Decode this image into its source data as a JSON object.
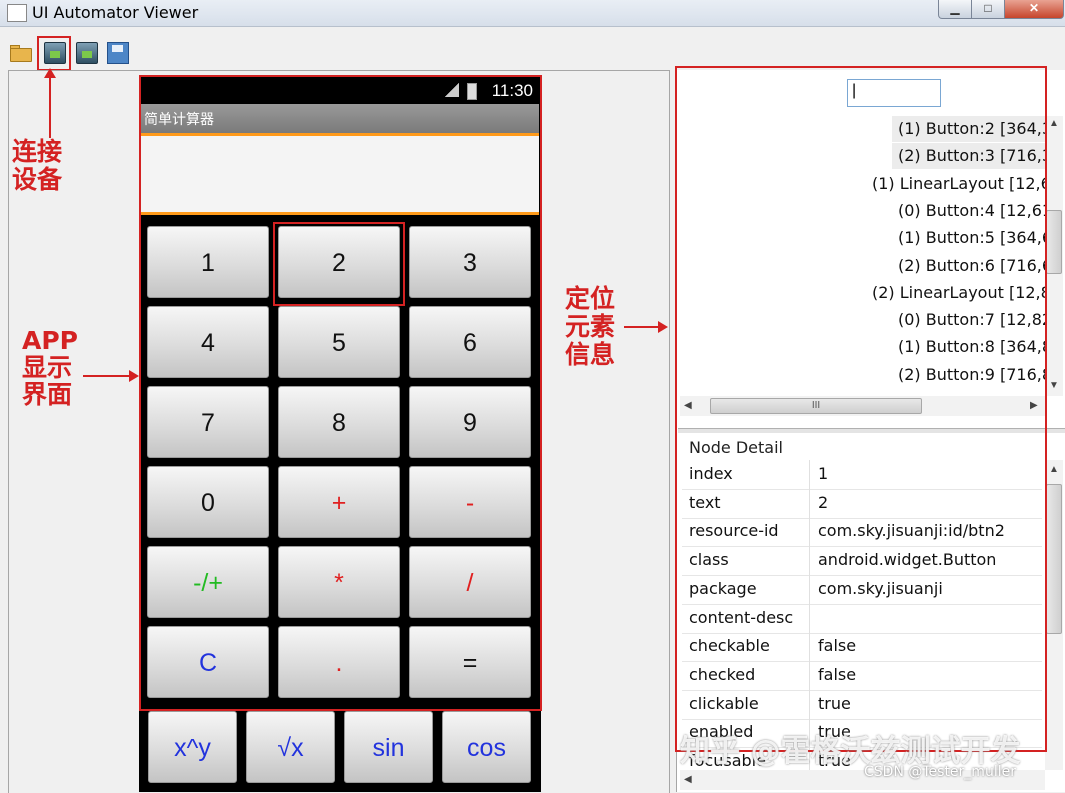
{
  "window": {
    "title": "UI Automator Viewer",
    "minimize_label": "▁",
    "maximize_label": "□",
    "close_label": "✕"
  },
  "toolbar": {
    "icons": [
      "open-folder-icon",
      "device-screenshot-icon",
      "device-screenshot-compressed-icon",
      "save-icon"
    ]
  },
  "device": {
    "time": "11:30",
    "app_title": "简单计算器",
    "buttons": [
      {
        "label": "1",
        "color": "#111111"
      },
      {
        "label": "2",
        "color": "#111111"
      },
      {
        "label": "3",
        "color": "#111111"
      },
      {
        "label": "4",
        "color": "#111111"
      },
      {
        "label": "5",
        "color": "#111111"
      },
      {
        "label": "6",
        "color": "#111111"
      },
      {
        "label": "7",
        "color": "#111111"
      },
      {
        "label": "8",
        "color": "#111111"
      },
      {
        "label": "9",
        "color": "#111111"
      },
      {
        "label": "0",
        "color": "#111111"
      },
      {
        "label": "+",
        "color": "#e02020"
      },
      {
        "label": "-",
        "color": "#e02020"
      },
      {
        "label": "-/+",
        "color": "#22bb22"
      },
      {
        "label": "*",
        "color": "#e02020"
      },
      {
        "label": "/",
        "color": "#e02020"
      },
      {
        "label": "C",
        "color": "#2233dd"
      },
      {
        "label": ".",
        "color": "#e02020"
      },
      {
        "label": "=",
        "color": "#111111"
      }
    ],
    "function_buttons": [
      "x^y",
      "√x",
      "sin",
      "cos"
    ]
  },
  "annotations": {
    "connect_device": "连接设备",
    "app_display": "APP显示界面",
    "locate_element": "定位元素信息"
  },
  "tree": {
    "rows": [
      "(1) Button:2 [364,3",
      "(2) Button:3 [716,3",
      "(1) LinearLayout [12,6",
      "(0) Button:4 [12,61",
      "(1) Button:5 [364,6",
      "(2) Button:6 [716,6",
      "(2) LinearLayout [12,8",
      "(0) Button:7 [12,82",
      "(1) Button:8 [364,8",
      "(2) Button:9 [716,8"
    ],
    "scroll_label": "III"
  },
  "node_detail": {
    "title": "Node Detail",
    "rows": [
      {
        "key": "index",
        "value": "1"
      },
      {
        "key": "text",
        "value": "2"
      },
      {
        "key": "resource-id",
        "value": "com.sky.jisuanji:id/btn2"
      },
      {
        "key": "class",
        "value": "android.widget.Button"
      },
      {
        "key": "package",
        "value": "com.sky.jisuanji"
      },
      {
        "key": "content-desc",
        "value": ""
      },
      {
        "key": "checkable",
        "value": "false"
      },
      {
        "key": "checked",
        "value": "false"
      },
      {
        "key": "clickable",
        "value": "true"
      },
      {
        "key": "enabled",
        "value": "true"
      },
      {
        "key": "focusable",
        "value": "true"
      }
    ]
  },
  "watermarks": {
    "zhihu": "知乎 @霍格沃兹测试开发",
    "csdn": "CSDN @Tester_muller"
  }
}
